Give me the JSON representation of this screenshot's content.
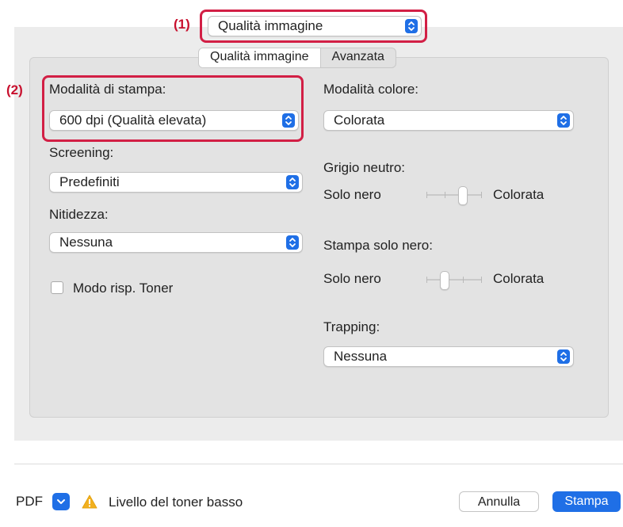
{
  "header": {
    "section_popup": "Qualità immagine",
    "callout_1": "(1)",
    "callout_2": "(2)"
  },
  "tabs": [
    {
      "label": "Qualità immagine",
      "active": true
    },
    {
      "label": "Avanzata",
      "active": false
    }
  ],
  "left": {
    "print_mode_label": "Modalità di stampa:",
    "print_mode_value": "600 dpi (Qualità elevata)",
    "screening_label": "Screening:",
    "screening_value": "Predefiniti",
    "sharpness_label": "Nitidezza:",
    "sharpness_value": "Nessuna",
    "toner_save_label": "Modo risp. Toner",
    "toner_save_checked": false
  },
  "right": {
    "color_mode_label": "Modalità colore:",
    "color_mode_value": "Colorata",
    "neutral_gray_label": "Grigio neutro:",
    "neutral_gray_min": "Solo nero",
    "neutral_gray_max": "Colorata",
    "neutral_gray_level": 0.66,
    "black_only_label": "Stampa solo nero:",
    "black_only_min": "Solo nero",
    "black_only_max": "Colorata",
    "black_only_level": 0.33,
    "trapping_label": "Trapping:",
    "trapping_value": "Nessuna"
  },
  "footer": {
    "pdf_label": "PDF",
    "warning_text": "Livello del toner basso",
    "cancel_label": "Annulla",
    "print_label": "Stampa"
  },
  "colors": {
    "accent": "#1f6fe6",
    "highlight": "#d21f45",
    "callout": "#c8102e",
    "warning": "#f2b01e"
  }
}
